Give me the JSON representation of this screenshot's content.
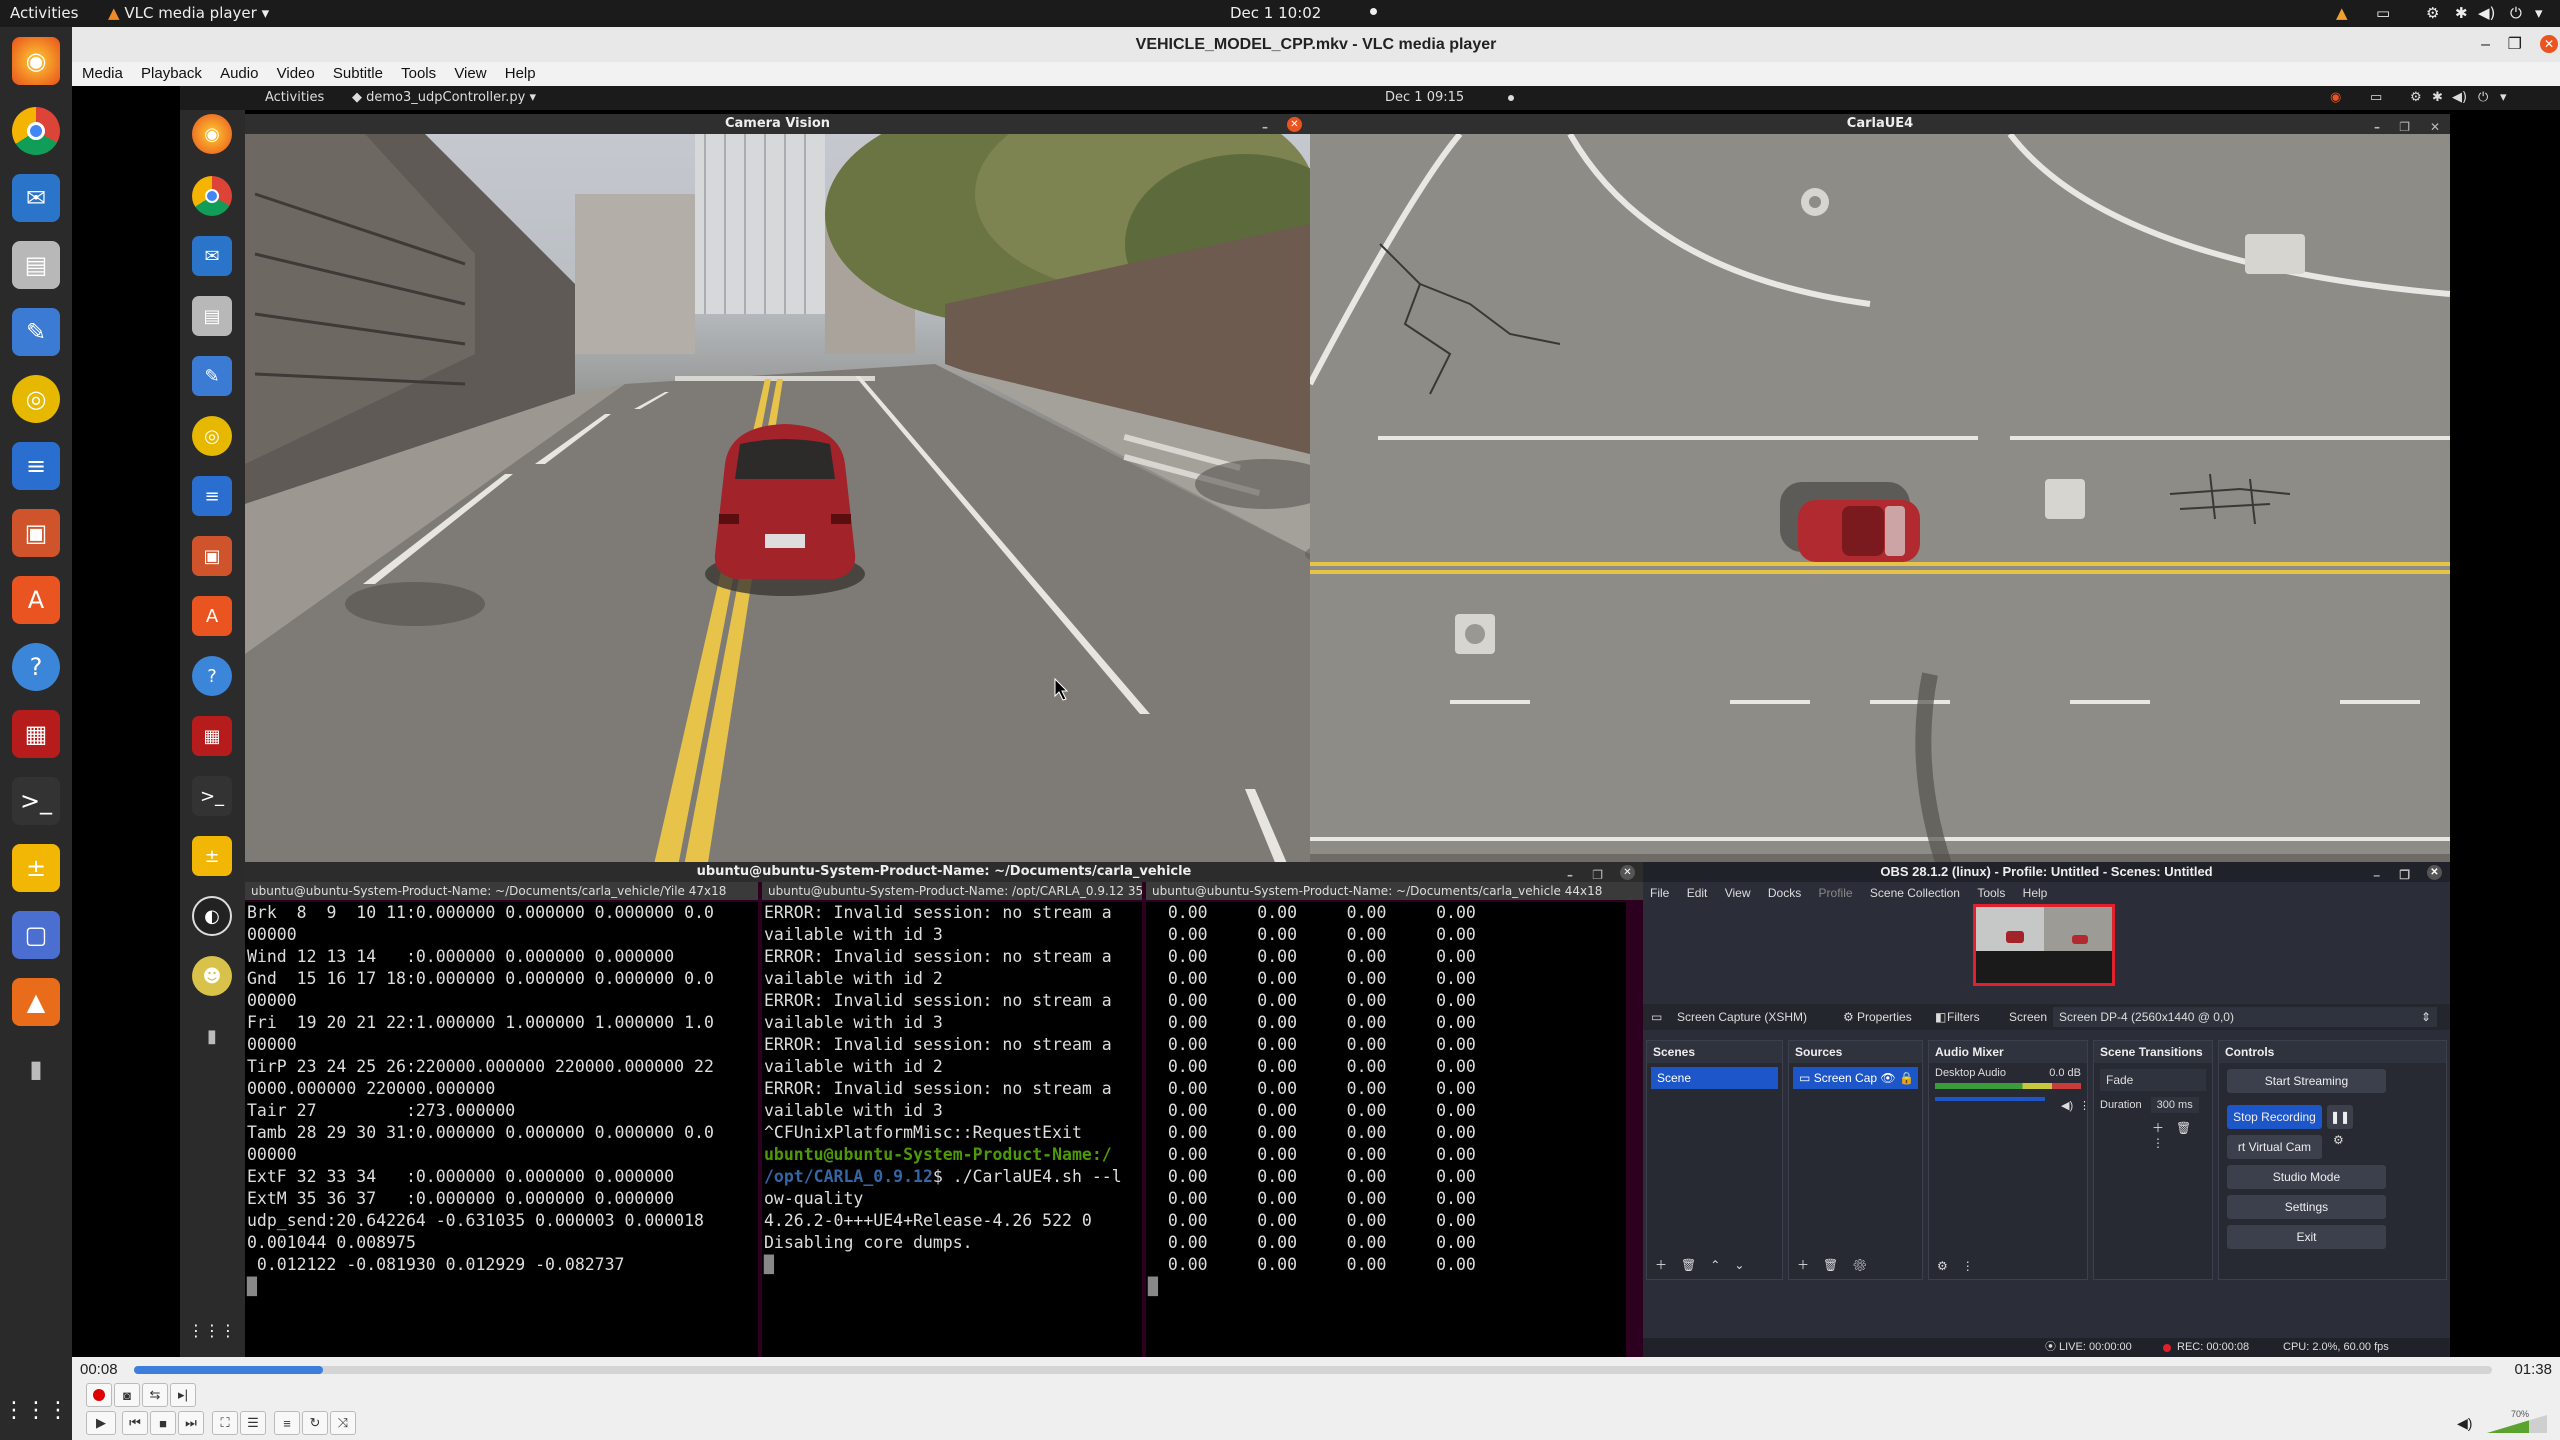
{
  "outer_topbar": {
    "activities": "Activities",
    "app_menu": "VLC media player",
    "clock": "Dec 1  10:02"
  },
  "vlc": {
    "window_title": "VEHICLE_MODEL_CPP.mkv - VLC media player",
    "menu": [
      "Media",
      "Playback",
      "Audio",
      "Video",
      "Subtitle",
      "Tools",
      "View",
      "Help"
    ],
    "time_elapsed": "00:08",
    "time_total": "01:38",
    "progress": 0.08,
    "volume_label": "70%"
  },
  "inner_desktop": {
    "activities": "Activities",
    "app_menu": "demo3_udpController.py",
    "clock": "Dec 1  09:15"
  },
  "camera_window": {
    "title": "Camera Vision"
  },
  "carla_window": {
    "title": "CarlaUE4"
  },
  "terminal": {
    "title": "ubuntu@ubuntu-System-Product-Name: ~/Documents/carla_vehicle",
    "tabs": [
      "ubuntu@ubuntu-System-Product-Name: ~/Documents/carla_vehicle/Yile 47x18",
      "ubuntu@ubuntu-System-Product-Name: /opt/CARLA_0.9.12 35",
      "ubuntu@ubuntu-System-Product-Name: ~/Documents/carla_vehicle 44x18"
    ],
    "pane1_lines": [
      "Brk  8  9  10 11:0.000000 0.000000 0.000000 0.0",
      "00000",
      "Wind 12 13 14   :0.000000 0.000000 0.000000",
      "Gnd  15 16 17 18:0.000000 0.000000 0.000000 0.0",
      "00000",
      "Fri  19 20 21 22:1.000000 1.000000 1.000000 1.0",
      "00000",
      "TirP 23 24 25 26:220000.000000 220000.000000 22",
      "0000.000000 220000.000000",
      "Tair 27         :273.000000",
      "Tamb 28 29 30 31:0.000000 0.000000 0.000000 0.0",
      "00000",
      "ExtF 32 33 34   :0.000000 0.000000 0.000000",
      "ExtM 35 36 37   :0.000000 0.000000 0.000000",
      "udp_send:20.642264 -0.631035 0.000003 0.000018",
      "0.001044 0.008975",
      " 0.012122 -0.081930 0.012929 -0.082737"
    ],
    "pane2_lines": [
      "ERROR: Invalid session: no stream a",
      "vailable with id 3",
      "ERROR: Invalid session: no stream a",
      "vailable with id 2",
      "ERROR: Invalid session: no stream a",
      "vailable with id 3",
      "ERROR: Invalid session: no stream a",
      "vailable with id 2",
      "ERROR: Invalid session: no stream a",
      "vailable with id 3",
      "^CFUnixPlatformMisc::RequestExit",
      ""
    ],
    "pane2_prompt_user": "ubuntu@ubuntu-System-Product-Name:",
    "pane2_prompt_path": "/opt/CARLA_0.9.12",
    "pane2_prompt_path_prefix": "/",
    "pane2_command": "$ ./CarlaUE4.sh --l",
    "pane2_tail": [
      "ow-quality",
      "4.26.2-0+++UE4+Release-4.26 522 0",
      "Disabling core dumps."
    ],
    "pane3_row": "  0.00     0.00     0.00     0.00",
    "pane3_row_count": 17
  },
  "obs": {
    "title": "OBS 28.1.2 (linux) - Profile: Untitled - Scenes: Untitled",
    "menu": [
      "File",
      "Edit",
      "View",
      "Docks",
      "Profile",
      "Scene Collection",
      "Tools",
      "Help"
    ],
    "source_bar": {
      "source": "Screen Capture (XSHM)",
      "properties": "Properties",
      "filters": "Filters",
      "screen_label": "Screen",
      "screen_value": "Screen DP-4 (2560x1440 @ 0,0)"
    },
    "docks": {
      "scenes": "Scenes",
      "sources": "Sources",
      "audio_mixer": "Audio Mixer",
      "scene_transitions": "Scene Transitions",
      "controls": "Controls"
    },
    "scene_item": "Scene",
    "source_item": "Screen Cap",
    "audio": {
      "name": "Desktop Audio",
      "level": "0.0 dB"
    },
    "transition": {
      "type": "Fade",
      "duration_label": "Duration",
      "duration_value": "300 ms"
    },
    "controls": {
      "start_streaming": "Start Streaming",
      "stop_recording": "Stop Recording",
      "virtual_cam": "rt Virtual Cam",
      "studio_mode": "Studio Mode",
      "settings": "Settings",
      "exit": "Exit"
    },
    "status": {
      "live": "LIVE: 00:00:00",
      "rec": "REC: 00:00:08",
      "cpu": "CPU: 2.0%, 60.00 fps"
    }
  },
  "colors": {
    "ubuntu_orange": "#e95420",
    "terminal_bg": "#000000",
    "obs_bg": "#2b2e38",
    "obs_accent": "#1d56c9",
    "road_line_yellow": "#e8c34a"
  }
}
